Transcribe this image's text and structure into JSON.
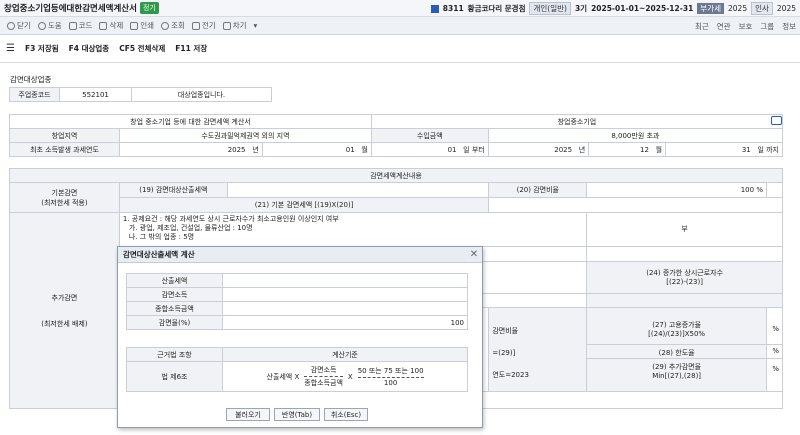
{
  "titlebar": {
    "title": "창업중소기업등에대한감면세액계산서",
    "badge": "정기",
    "company_code": "8311",
    "company_name": "황금코다리 문경점",
    "biz_type": "개인(일반)",
    "term": "3기",
    "period": "2025-01-01~2025-12-31",
    "vat_tag": "부가세",
    "vat_year": "2025",
    "person_tag": "인사",
    "person_year": "2025"
  },
  "toolbar": {
    "items": [
      "닫기",
      "도움",
      "코드",
      "삭제",
      "인쇄",
      "조회",
      "전기",
      "차기"
    ],
    "right_items": [
      "최근",
      "연관",
      "보호",
      "그룹",
      "정보"
    ]
  },
  "fnbar": {
    "items": [
      "F3 저장됨",
      "F4 대상업종",
      "CF5 전체삭제",
      "F11 저장"
    ]
  },
  "section": {
    "title": "감면대상업종",
    "code_label": "주업종코드",
    "code_value": "552101",
    "status": "대상업종입니다."
  },
  "form": {
    "title": "창업 중소기업 등에 대한 감면세액 계산서",
    "type": "창업중소기업",
    "region_label": "창업지역",
    "region_value": "수도권과밀억제권역 외의 지역",
    "income_label": "수입금액",
    "income_value": "8,000만원 초과",
    "first_year_label": "최초 소득발생 과세연도",
    "from_year": "2025",
    "from_month": "01",
    "from_day": "01",
    "to_year": "2025",
    "to_month": "12",
    "to_day": "31",
    "u_year": "년",
    "u_month": "월",
    "u_from": "일 부터",
    "u_to": "일 까지",
    "calc_title": "감면세액계산내용",
    "basic_label": "기본감면",
    "basic_sub": "(최저한세 적용)",
    "row19": "(19) 감면대상산출세액",
    "row20": "(20) 감면비율",
    "row20_val": "100",
    "pct": "%",
    "row21": "(21) 기본 감면세액 [(19)X(20)]",
    "req1": "1. 공제요건 : 해당 과세연도 상시 근로자수가 최소고용인원 이상인지 여부",
    "req2": "가. 광업, 제조업, 건설업, 물류산업 : 10명",
    "req3": "나. 그 밖의 업종 : 5명",
    "req_val": "부",
    "add_label": "추가감면",
    "add_sub": "(최저한세 배제)",
    "row24": "(24) 증가한 상시근로자수",
    "row24_sub": "[(22)-(23)]",
    "rate_label": "감면비율",
    "row27": "(27) 고용증가율",
    "row27_sub": "[(24)/(23)]X50%",
    "frag1": "=(29)]",
    "row28": "(28) 한도율",
    "frag2": "연도=2023",
    "row29": "(29) 추가감면율",
    "row29_sub": "Min[(27),(28)]"
  },
  "modal": {
    "title": "감면대상산출세액 계산",
    "close": "✕",
    "rows": [
      "산출세액",
      "감면소득",
      "종합소득금액",
      "감면율(%)"
    ],
    "rate_value": "100",
    "law_header": "근거법 조항",
    "basis_header": "계산기준",
    "law": "법 제6조",
    "formula_prefix": "산출세액 X",
    "frac1_num": "감면소득",
    "frac1_den": "종합소득금액",
    "times": "X",
    "frac2_num": "50 또는 75 또는 100",
    "frac2_den": "100",
    "btn_load": "불러오기",
    "btn_apply": "반영(Tab)",
    "btn_cancel": "취소(Esc)"
  },
  "colors": {
    "accent": "#2a5bb8",
    "badge": "#2f9a4a"
  }
}
